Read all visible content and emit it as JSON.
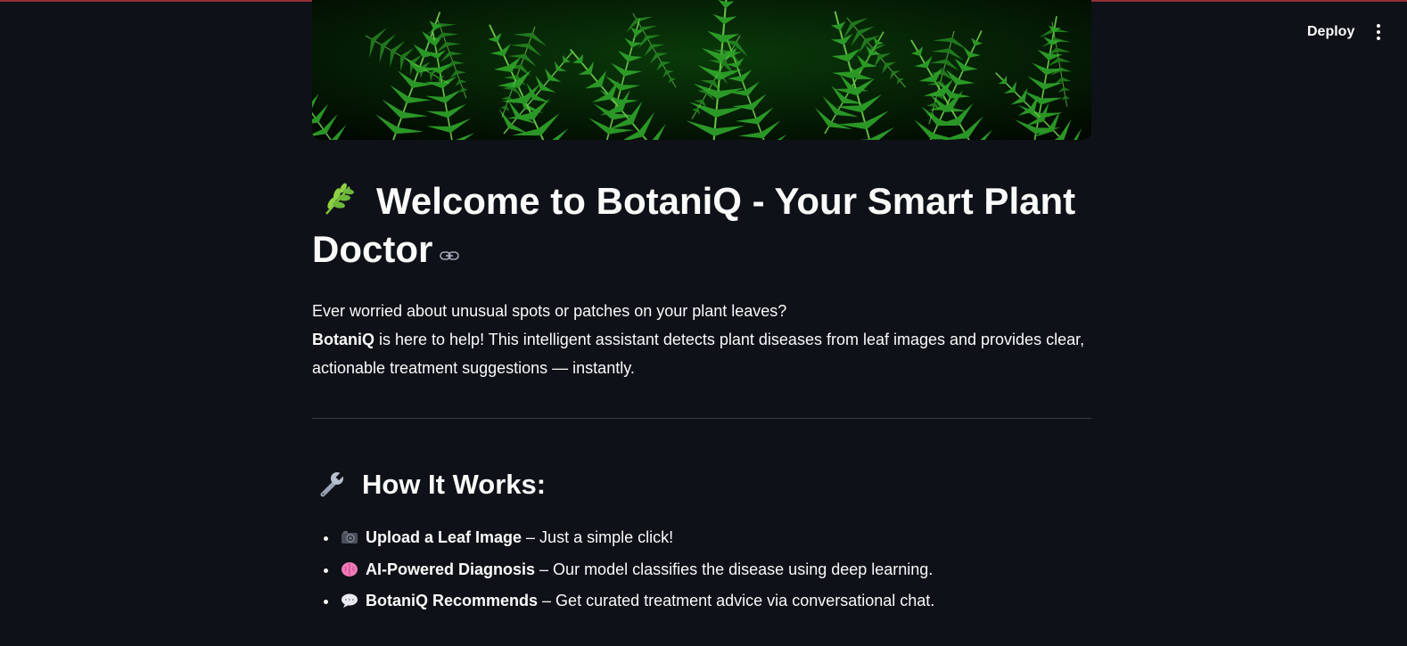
{
  "header": {
    "deploy_label": "Deploy",
    "menu_icon": "more-vertical-icon"
  },
  "colors": {
    "background": "#0e1117",
    "text": "#fafafa",
    "accent": "#ff4b4b",
    "divider": "#3a3d46"
  },
  "banner": {
    "image": "fern-leaves-banner"
  },
  "title": {
    "icon": "herb-icon",
    "text": "Welcome to BotaniQ - Your Smart Plant Doctor",
    "link_icon": "link-icon"
  },
  "intro": {
    "line1": "Ever worried about unusual spots or patches on your plant leaves?",
    "brand": "BotaniQ",
    "line2": " is here to help! This intelligent assistant detects plant diseases from leaf images and provides clear, actionable treatment suggestions — instantly."
  },
  "how": {
    "icon": "wrench-icon",
    "title": "How It Works:",
    "steps": [
      {
        "icon": "camera-icon",
        "strong": "Upload a Leaf Image",
        "text": " – Just a simple click!"
      },
      {
        "icon": "brain-icon",
        "strong": "AI-Powered Diagnosis",
        "text": " – Our model classifies the disease using deep learning."
      },
      {
        "icon": "speech-bubble-icon",
        "strong": "BotaniQ Recommends",
        "text": " – Get curated treatment advice via conversational chat."
      }
    ]
  }
}
